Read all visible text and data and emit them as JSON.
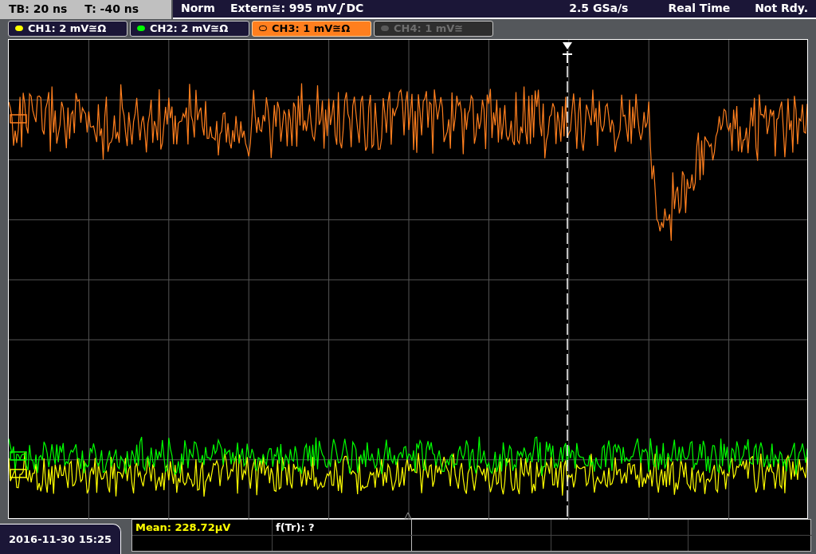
{
  "status_left": {
    "timebase": "TB: 20 ns",
    "trigger_time": "T: -40 ns"
  },
  "status_right": {
    "mode": "Norm",
    "trigger_source": "Extern≅: 995 mV",
    "coupling": "DC",
    "sample_rate": "2.5 GSa/s",
    "acquisition": "Real Time",
    "state": "Not Rdy."
  },
  "channels": [
    {
      "label": "CH1: 2 mV≅Ω",
      "color": "#ffff00",
      "selected": false,
      "enabled": true
    },
    {
      "label": "CH2: 2 mV≅Ω",
      "color": "#00ff00",
      "selected": false,
      "enabled": true
    },
    {
      "label": "CH3: 1 mV≅Ω",
      "color": "#ff7f1e",
      "selected": true,
      "enabled": true
    },
    {
      "label": "CH4: 1 mV≅",
      "color": "#5a5a5a",
      "selected": false,
      "enabled": false
    }
  ],
  "date_time": "2016-11-30 15:25",
  "measurements": {
    "rows": [
      [
        "Mean: 228.72µV",
        "f(Tr): ?"
      ]
    ]
  }
}
